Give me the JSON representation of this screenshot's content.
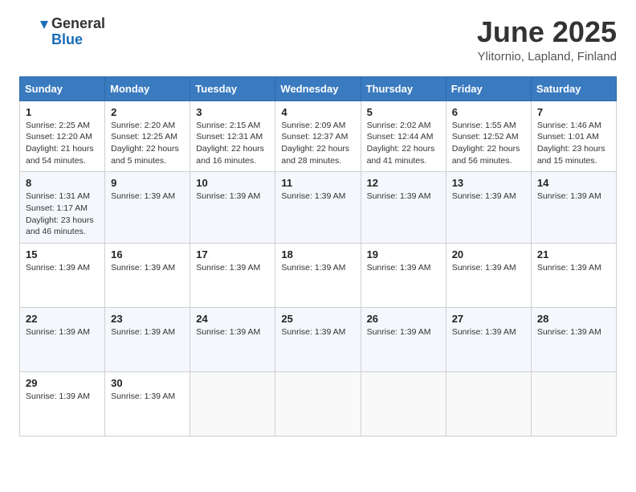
{
  "header": {
    "logo_line1": "General",
    "logo_line2": "Blue",
    "month_year": "June 2025",
    "location": "Ylitornio, Lapland, Finland"
  },
  "days_of_week": [
    "Sunday",
    "Monday",
    "Tuesday",
    "Wednesday",
    "Thursday",
    "Friday",
    "Saturday"
  ],
  "weeks": [
    [
      {
        "day": "1",
        "info": "Sunrise: 2:25 AM\nSunset: 12:20 AM\nDaylight: 21 hours and 54 minutes."
      },
      {
        "day": "2",
        "info": "Sunrise: 2:20 AM\nSunset: 12:25 AM\nDaylight: 22 hours and 5 minutes."
      },
      {
        "day": "3",
        "info": "Sunrise: 2:15 AM\nSunset: 12:31 AM\nDaylight: 22 hours and 16 minutes."
      },
      {
        "day": "4",
        "info": "Sunrise: 2:09 AM\nSunset: 12:37 AM\nDaylight: 22 hours and 28 minutes."
      },
      {
        "day": "5",
        "info": "Sunrise: 2:02 AM\nSunset: 12:44 AM\nDaylight: 22 hours and 41 minutes."
      },
      {
        "day": "6",
        "info": "Sunrise: 1:55 AM\nSunset: 12:52 AM\nDaylight: 22 hours and 56 minutes."
      },
      {
        "day": "7",
        "info": "Sunrise: 1:46 AM\nSunset: 1:01 AM\nDaylight: 23 hours and 15 minutes."
      }
    ],
    [
      {
        "day": "8",
        "info": "Sunrise: 1:31 AM\nSunset: 1:17 AM\nDaylight: 23 hours and 46 minutes."
      },
      {
        "day": "9",
        "info": "Sunrise: 1:39 AM"
      },
      {
        "day": "10",
        "info": "Sunrise: 1:39 AM"
      },
      {
        "day": "11",
        "info": "Sunrise: 1:39 AM"
      },
      {
        "day": "12",
        "info": "Sunrise: 1:39 AM"
      },
      {
        "day": "13",
        "info": "Sunrise: 1:39 AM"
      },
      {
        "day": "14",
        "info": "Sunrise: 1:39 AM"
      }
    ],
    [
      {
        "day": "15",
        "info": "Sunrise: 1:39 AM"
      },
      {
        "day": "16",
        "info": "Sunrise: 1:39 AM"
      },
      {
        "day": "17",
        "info": "Sunrise: 1:39 AM"
      },
      {
        "day": "18",
        "info": "Sunrise: 1:39 AM"
      },
      {
        "day": "19",
        "info": "Sunrise: 1:39 AM"
      },
      {
        "day": "20",
        "info": "Sunrise: 1:39 AM"
      },
      {
        "day": "21",
        "info": "Sunrise: 1:39 AM"
      }
    ],
    [
      {
        "day": "22",
        "info": "Sunrise: 1:39 AM"
      },
      {
        "day": "23",
        "info": "Sunrise: 1:39 AM"
      },
      {
        "day": "24",
        "info": "Sunrise: 1:39 AM"
      },
      {
        "day": "25",
        "info": "Sunrise: 1:39 AM"
      },
      {
        "day": "26",
        "info": "Sunrise: 1:39 AM"
      },
      {
        "day": "27",
        "info": "Sunrise: 1:39 AM"
      },
      {
        "day": "28",
        "info": "Sunrise: 1:39 AM"
      }
    ],
    [
      {
        "day": "29",
        "info": "Sunrise: 1:39 AM"
      },
      {
        "day": "30",
        "info": "Sunrise: 1:39 AM"
      },
      {
        "day": "",
        "info": ""
      },
      {
        "day": "",
        "info": ""
      },
      {
        "day": "",
        "info": ""
      },
      {
        "day": "",
        "info": ""
      },
      {
        "day": "",
        "info": ""
      }
    ]
  ]
}
